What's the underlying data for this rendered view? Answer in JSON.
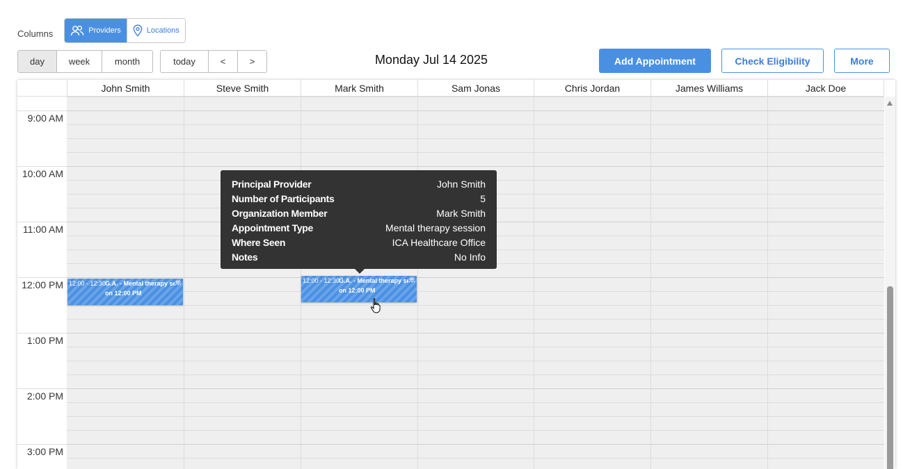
{
  "columns": {
    "label": "Columns",
    "options": [
      {
        "label": "Providers",
        "icon": "users-icon",
        "active": true
      },
      {
        "label": "Locations",
        "icon": "location-pin-icon",
        "active": false
      }
    ]
  },
  "views": [
    {
      "label": "day",
      "active": true
    },
    {
      "label": "week",
      "active": false
    },
    {
      "label": "month",
      "active": false
    }
  ],
  "nav": {
    "today": "today",
    "prev": "<",
    "next": ">"
  },
  "date_title": "Monday Jul 14 2025",
  "actions": {
    "add_appointment": "Add Appointment",
    "check_eligibility": "Check Eligibility",
    "more": "More"
  },
  "providers": [
    "John Smith",
    "Steve Smith",
    "Mark Smith",
    "Sam Jonas",
    "Chris Jordan",
    "James Williams",
    "Jack Doe"
  ],
  "time_slots": [
    "9:00 AM",
    "10:00 AM",
    "11:00 AM",
    "12:00 PM",
    "1:00 PM",
    "2:00 PM",
    "3:00 PM"
  ],
  "events": [
    {
      "time": "12:00 - 12:30",
      "title": "G.A. - Mental therapy session",
      "subtitle": "on 12:00 PM",
      "provider": "John Smith"
    },
    {
      "time": "12:00 - 12:30",
      "title": "G.A. - Mental therapy session",
      "subtitle": "on 12:00 PM",
      "provider": "Mark Smith"
    }
  ],
  "tooltip": [
    {
      "label": "Principal Provider",
      "value": "John Smith"
    },
    {
      "label": "Number of Participants",
      "value": "5"
    },
    {
      "label": "Organization Member",
      "value": "Mark Smith"
    },
    {
      "label": "Appointment Type",
      "value": "Mental therapy session"
    },
    {
      "label": "Where Seen",
      "value": "ICA Healthcare Office"
    },
    {
      "label": "Notes",
      "value": "No Info"
    }
  ],
  "colors": {
    "accent": "#4a90e2",
    "tooltip_bg": "#333333",
    "grid_bg": "#efefef"
  }
}
